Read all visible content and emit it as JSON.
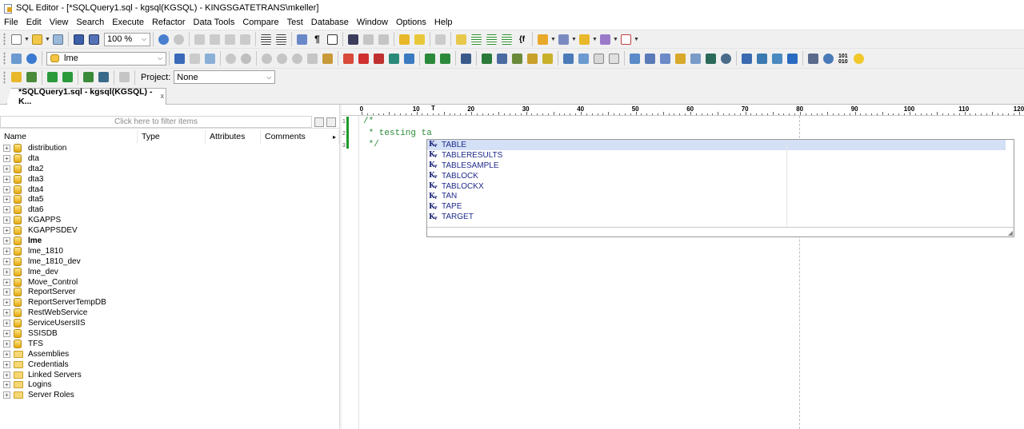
{
  "window": {
    "title": "SQL Editor - [*SQLQuery1.sql - kgsql(KGSQL) - KINGSGATETRANS\\mkeller]"
  },
  "menu": [
    "File",
    "Edit",
    "View",
    "Search",
    "Execute",
    "Refactor",
    "Data Tools",
    "Compare",
    "Test",
    "Database",
    "Window",
    "Options",
    "Help"
  ],
  "toolbar1": {
    "zoom": "100 %"
  },
  "toolbar2": {
    "database": "lme"
  },
  "toolbar3": {
    "project_label": "Project:",
    "project_value": "None"
  },
  "tab": {
    "label": "*SQLQuery1.sql - kgsql(KGSQL) - K...",
    "close": "x"
  },
  "explorer": {
    "filter_placeholder": "Click here to filter items",
    "columns": [
      "Name",
      "Type",
      "Attributes",
      "Comments"
    ],
    "more": "▸",
    "items": [
      {
        "label": "distribution",
        "kind": "db"
      },
      {
        "label": "dta",
        "kind": "db"
      },
      {
        "label": "dta2",
        "kind": "db"
      },
      {
        "label": "dta3",
        "kind": "db"
      },
      {
        "label": "dta4",
        "kind": "db"
      },
      {
        "label": "dta5",
        "kind": "db"
      },
      {
        "label": "dta6",
        "kind": "db"
      },
      {
        "label": "KGAPPS",
        "kind": "db"
      },
      {
        "label": "KGAPPSDEV",
        "kind": "db"
      },
      {
        "label": "lme",
        "kind": "db",
        "bold": true
      },
      {
        "label": "lme_1810",
        "kind": "db"
      },
      {
        "label": "lme_1810_dev",
        "kind": "db"
      },
      {
        "label": "lme_dev",
        "kind": "db"
      },
      {
        "label": "Move_Control",
        "kind": "db"
      },
      {
        "label": "ReportServer",
        "kind": "db"
      },
      {
        "label": "ReportServerTempDB",
        "kind": "db"
      },
      {
        "label": "RestWebService",
        "kind": "db"
      },
      {
        "label": "ServiceUsersIIS",
        "kind": "db"
      },
      {
        "label": "SSISDB",
        "kind": "db"
      },
      {
        "label": "TFS",
        "kind": "db"
      },
      {
        "label": "Assemblies",
        "kind": "folder"
      },
      {
        "label": "Credentials",
        "kind": "folder"
      },
      {
        "label": "Linked Servers",
        "kind": "folder"
      },
      {
        "label": "Logins",
        "kind": "folder"
      },
      {
        "label": "Server Roles",
        "kind": "folder"
      }
    ]
  },
  "ruler": {
    "labels": [
      "0",
      "10",
      "20",
      "30",
      "40",
      "50",
      "60",
      "70",
      "80",
      "90",
      "100",
      "110",
      "120"
    ]
  },
  "editor": {
    "line_numbers": [
      "1",
      "2",
      "3"
    ],
    "lines": [
      "/*",
      " * testing ta",
      " */"
    ]
  },
  "autocomplete": {
    "icon_text": "Kᵧ",
    "items": [
      "TABLE",
      "TABLERESULTS",
      "TABLESAMPLE",
      "TABLOCK",
      "TABLOCKX",
      "TAN",
      "TAPE",
      "TARGET"
    ],
    "selected_index": 0
  },
  "colors": {
    "comment": "#2e8b3a",
    "keyword": "#1e2a8a",
    "change_bar": "#1a9a2a"
  }
}
